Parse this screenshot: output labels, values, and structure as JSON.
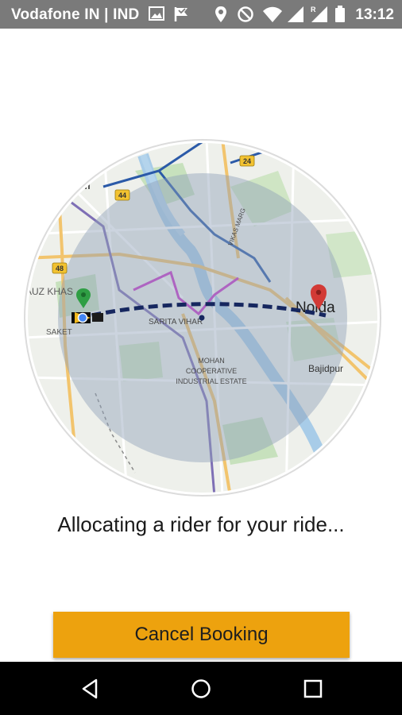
{
  "status_bar": {
    "carrier": "Vodafone IN | IND",
    "time": "13:12",
    "icons": [
      "image-icon",
      "flag-icon",
      "location-icon",
      "do-not-disturb-icon",
      "wifi-icon",
      "signal-icon",
      "roaming-signal-icon",
      "battery-icon"
    ],
    "roaming_label": "R"
  },
  "map": {
    "labels": {
      "city_left": "hi",
      "area_hauz_khas": "AUZ KHAS",
      "area_saket": "SAKET",
      "area_sarita_vihar": "SARITA VIHAR",
      "estate_line1": "MOHAN",
      "estate_line2": "COOPERATIVE",
      "estate_line3": "INDUSTRIAL ESTATE",
      "destination_city": "Noida",
      "town_bajidpur": "Bajidpur",
      "road_24": "24",
      "road_44": "44",
      "road_48": "48",
      "vikas_marg": "VIKAS MARG"
    },
    "markers": [
      "origin-pin-icon",
      "destination-pin-icon",
      "rider-bike-icon",
      "current-location-dot"
    ]
  },
  "message": "Allocating a rider for your ride...",
  "cancel_button": "Cancel Booking",
  "nav_bar": [
    "back-icon",
    "home-icon",
    "recents-icon"
  ],
  "colors": {
    "accent": "#eda20e",
    "route": "#16275f",
    "status_bar": "#7a7a7a",
    "nav_bar": "#000000",
    "overlay": "#8fa0b8",
    "origin_pin": "#2f9e44",
    "destination_pin": "#d23a36"
  }
}
